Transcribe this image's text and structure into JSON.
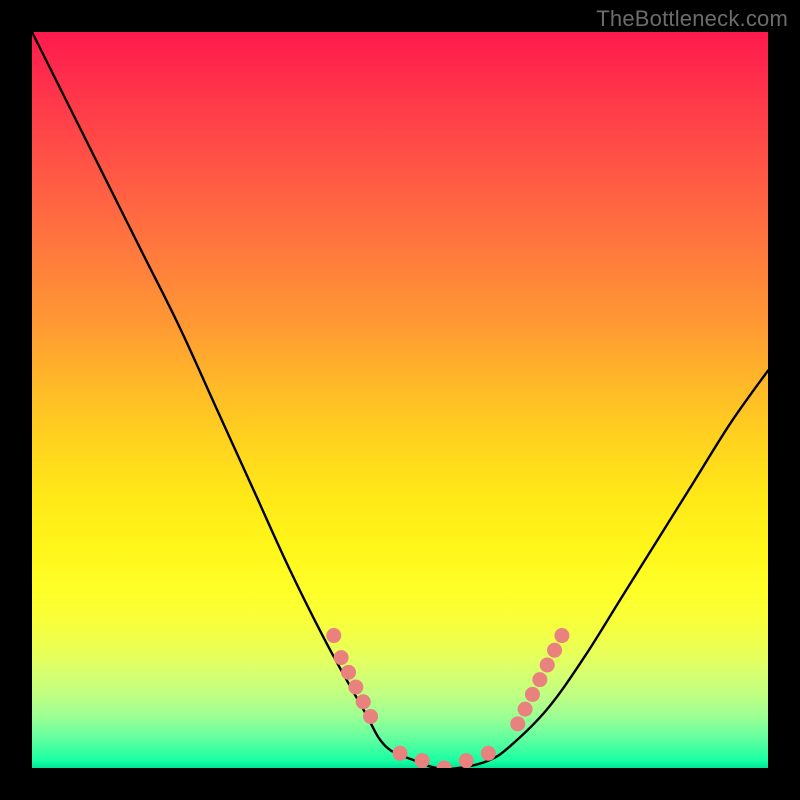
{
  "attribution": {
    "label": "TheBottleneck.com"
  },
  "colors": {
    "background": "#000000",
    "curve": "#000000",
    "dots": "#e9817f",
    "gradient_top": "#ff1a4d",
    "gradient_mid": "#ffe818",
    "gradient_bottom": "#00e598"
  },
  "chart_data": {
    "type": "line",
    "title": "",
    "xlabel": "",
    "ylabel": "",
    "xlim": [
      0,
      100
    ],
    "ylim": [
      0,
      100
    ],
    "series": [
      {
        "name": "bottleneck-curve",
        "x": [
          0,
          5,
          10,
          15,
          20,
          25,
          30,
          35,
          40,
          45,
          48,
          52,
          55,
          58,
          62,
          65,
          70,
          75,
          80,
          85,
          90,
          95,
          100
        ],
        "y": [
          100,
          90,
          80,
          70,
          60,
          49,
          38,
          27,
          17,
          8,
          3,
          1,
          0,
          0,
          1,
          3,
          8,
          15,
          23,
          31,
          39,
          47,
          54
        ]
      }
    ],
    "highlight_dots": [
      {
        "x": 41,
        "y": 18
      },
      {
        "x": 42,
        "y": 15
      },
      {
        "x": 43,
        "y": 13
      },
      {
        "x": 44,
        "y": 11
      },
      {
        "x": 45,
        "y": 9
      },
      {
        "x": 46,
        "y": 7
      },
      {
        "x": 50,
        "y": 2
      },
      {
        "x": 53,
        "y": 1
      },
      {
        "x": 56,
        "y": 0
      },
      {
        "x": 59,
        "y": 1
      },
      {
        "x": 62,
        "y": 2
      },
      {
        "x": 66,
        "y": 6
      },
      {
        "x": 67,
        "y": 8
      },
      {
        "x": 68,
        "y": 10
      },
      {
        "x": 69,
        "y": 12
      },
      {
        "x": 70,
        "y": 14
      },
      {
        "x": 71,
        "y": 16
      },
      {
        "x": 72,
        "y": 18
      }
    ]
  }
}
